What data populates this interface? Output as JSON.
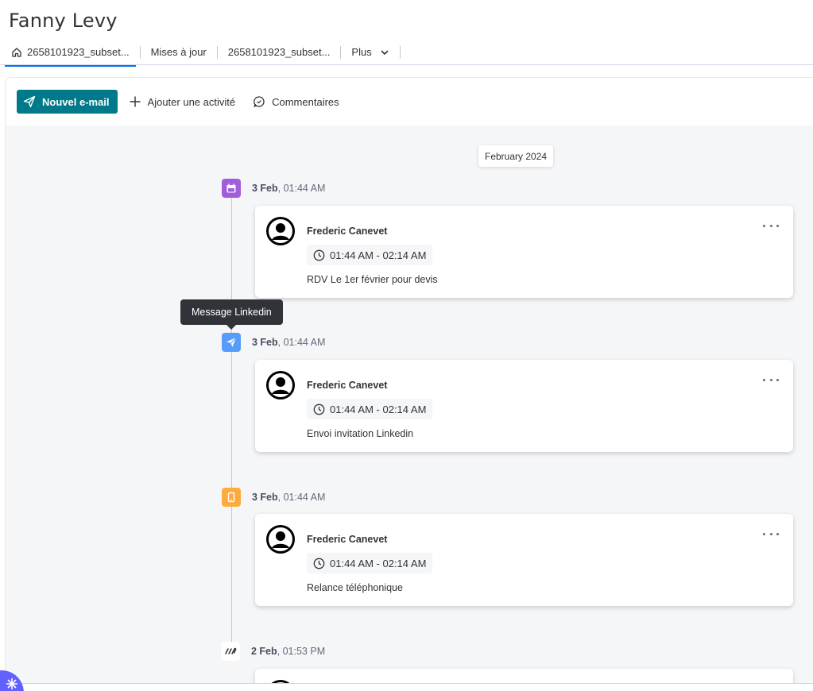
{
  "header": {
    "title": "Fanny Levy"
  },
  "tabs": [
    {
      "label": "2658101923_subset...",
      "icon": "home-icon",
      "active": true
    },
    {
      "label": "Mises à jour"
    },
    {
      "label": "2658101923_subset..."
    },
    {
      "label": "Plus",
      "icon": "chevron-down-icon"
    }
  ],
  "toolbar": {
    "new_email_label": "Nouvel e-mail",
    "add_activity_label": "Ajouter une activité",
    "comments_label": "Commentaires"
  },
  "timeline": {
    "month_label": "February 2024",
    "tooltip": "Message Linkedin",
    "entries": [
      {
        "type": "calendar-icon",
        "color": "#a25ddc",
        "date_bold": "3 Feb",
        "date_rest": ", 01:44 AM",
        "author": "Frederic Canevet",
        "time_range": "01:44 AM - 02:14 AM",
        "description": "RDV Le 1er février pour devis"
      },
      {
        "type": "send-icon",
        "color": "#579bfc",
        "date_bold": "3 Feb",
        "date_rest": ", 01:44 AM",
        "author": "Frederic Canevet",
        "time_range": "01:44 AM - 02:14 AM",
        "description": "Envoi invitation Linkedin"
      },
      {
        "type": "phone-icon",
        "color": "#fdab3d",
        "date_bold": "3 Feb",
        "date_rest": ", 01:44 AM",
        "author": "Frederic Canevet",
        "time_range": "01:44 AM - 02:14 AM",
        "description": "Relance téléphonique"
      },
      {
        "type": "monday-logo-icon",
        "color": "#ffffff",
        "date_bold": "2 Feb",
        "date_rest": ", 01:53 PM"
      }
    ]
  },
  "colors": {
    "primary_button": "#007a8a",
    "background": "#f5f6f8"
  }
}
